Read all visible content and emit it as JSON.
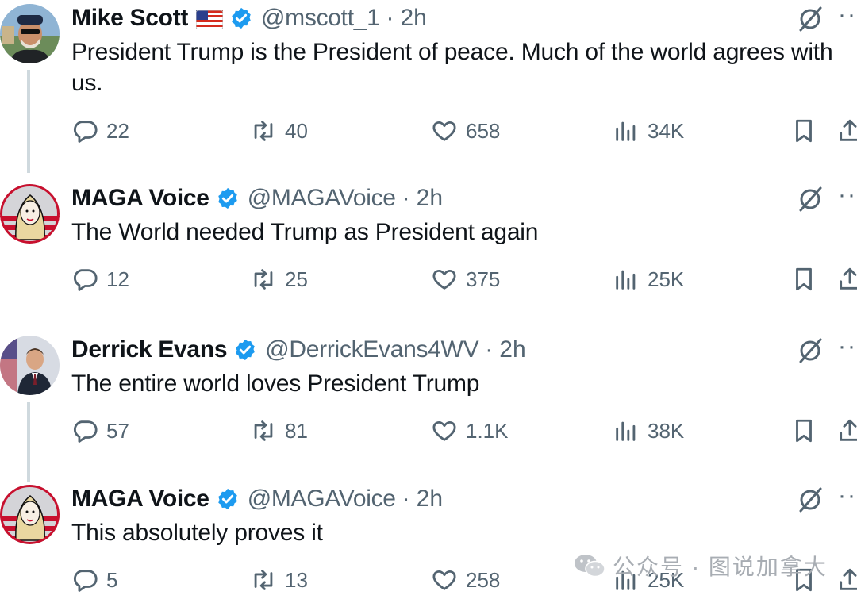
{
  "tweets": [
    {
      "name": "Mike Scott",
      "has_flag": true,
      "flag_emoji": "us-flag",
      "handle": "@mscott_1",
      "time": "2h",
      "text": "President Trump is the President of peace. Much of the world agrees with us.",
      "replies": "22",
      "retweets": "40",
      "likes": "658",
      "views": "34K"
    },
    {
      "name": "MAGA Voice",
      "has_flag": false,
      "handle": "@MAGAVoice",
      "time": "2h",
      "text": "The World needed Trump as President again",
      "replies": "12",
      "retweets": "25",
      "likes": "375",
      "views": "25K"
    },
    {
      "name": "Derrick Evans",
      "has_flag": false,
      "handle": "@DerrickEvans4WV",
      "time": "2h",
      "text": "The entire world loves President Trump",
      "replies": "57",
      "retweets": "81",
      "likes": "1.1K",
      "views": "38K"
    },
    {
      "name": "MAGA Voice",
      "has_flag": false,
      "handle": "@MAGAVoice",
      "time": "2h",
      "text": "This absolutely proves it",
      "replies": "5",
      "retweets": "13",
      "likes": "258",
      "views": "25K"
    }
  ],
  "separator": "·",
  "more_label": "··",
  "watermark": {
    "text": "公众号 · 图说加拿大",
    "icon": "wechat-icon"
  },
  "colors": {
    "verified": "#1d9bf0",
    "muted": "#536471",
    "text": "#0f1419",
    "thread_line": "#cfd9de"
  }
}
